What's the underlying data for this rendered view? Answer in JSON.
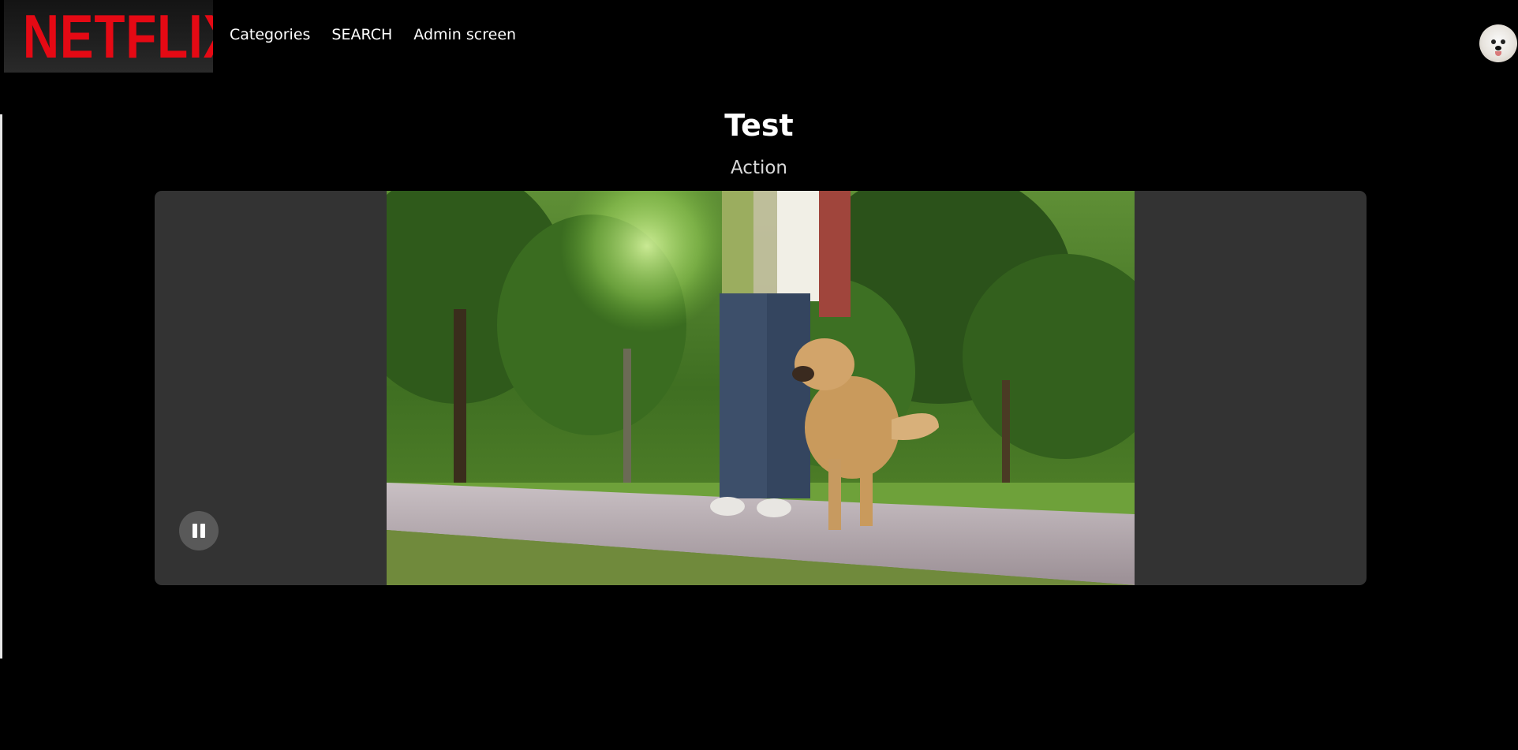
{
  "header": {
    "logo_text": "NETFLIX",
    "nav": [
      {
        "label": "Categories"
      },
      {
        "label": "SEARCH"
      },
      {
        "label": "Admin screen"
      }
    ],
    "avatar_icon": "dog-avatar-icon"
  },
  "movie": {
    "title": "Test",
    "genre": "Action"
  },
  "player": {
    "state": "playing",
    "control_icon": "pause-icon"
  },
  "colors": {
    "background": "#000000",
    "brand": "#e50914",
    "player_bg": "#333333",
    "control_bg": "#595959"
  }
}
